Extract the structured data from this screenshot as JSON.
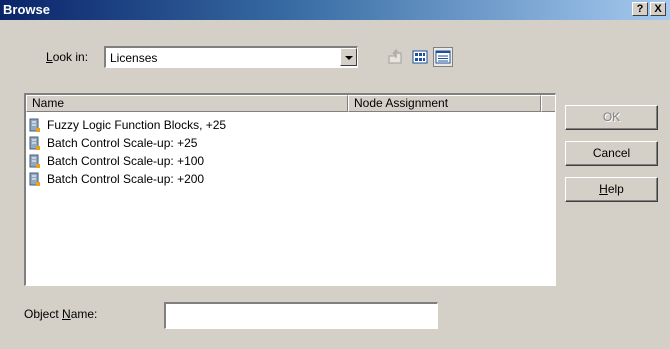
{
  "window": {
    "title": "Browse",
    "help_button": "?",
    "close_button": "X"
  },
  "look_in": {
    "label_accel": "L",
    "label_rest": "ook in:",
    "value": "Licenses"
  },
  "toolbar": {
    "icons": [
      "up-folder-icon",
      "list-view-icon",
      "details-view-icon"
    ]
  },
  "list": {
    "columns": [
      "Name",
      "Node Assignment"
    ],
    "items": [
      {
        "name": "Fuzzy Logic Function Blocks, +25",
        "node_assignment": ""
      },
      {
        "name": "Batch Control Scale-up: +25",
        "node_assignment": ""
      },
      {
        "name": "Batch Control Scale-up: +100",
        "node_assignment": ""
      },
      {
        "name": "Batch Control Scale-up: +200",
        "node_assignment": ""
      }
    ]
  },
  "buttons": {
    "ok": "OK",
    "cancel": "Cancel",
    "help_accel": "H",
    "help_rest": "elp"
  },
  "object_name": {
    "label_pre": "Object ",
    "label_accel": "N",
    "label_rest": "ame:",
    "value": ""
  },
  "colors": {
    "face": "#d4d0c8",
    "title_start": "#0a246a",
    "title_end": "#a6caf0"
  }
}
